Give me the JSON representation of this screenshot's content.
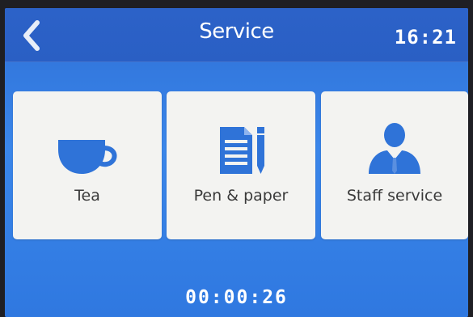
{
  "header": {
    "title": "Service",
    "time": "16:21",
    "back_icon": "chevron-left-icon"
  },
  "tiles": [
    {
      "label": "Tea",
      "icon": "teacup-icon"
    },
    {
      "label": "Pen & paper",
      "icon": "document-pen-icon"
    },
    {
      "label": "Staff service",
      "icon": "staff-person-icon"
    }
  ],
  "timer": "00:00:26",
  "colors": {
    "background": "#3a86ea",
    "header": "#2a5fc4",
    "tile": "#f3f3f1",
    "icon": "#2f73d8",
    "text_dark": "#3a3a3a",
    "text_light": "#ffffff"
  }
}
